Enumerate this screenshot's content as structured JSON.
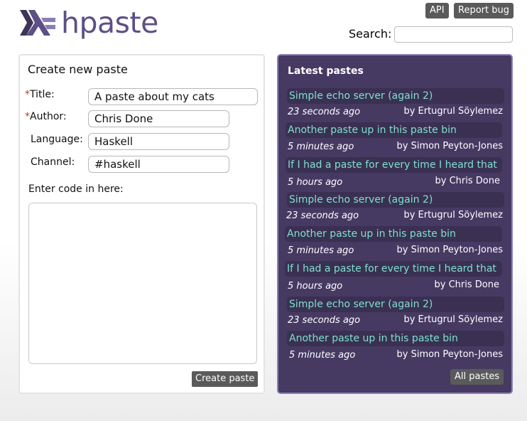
{
  "header": {
    "logo_text": "hpaste",
    "api_label": "API",
    "report_bug_label": "Report bug",
    "search_label": "Search:",
    "search_value": ""
  },
  "form": {
    "title": "Create new paste",
    "required_mark": "*",
    "title_label": "Title:",
    "title_value": "A paste about my cats",
    "author_label": "Author:",
    "author_value": "Chris Done",
    "language_label": "Language:",
    "language_value": "Haskell",
    "channel_label": "Channel:",
    "channel_value": "#haskell",
    "code_label": "Enter code in here:",
    "code_value": "",
    "submit_label": "Create paste"
  },
  "latest": {
    "title": "Latest pastes",
    "all_label": "All pastes",
    "items": [
      {
        "title": "Simple echo server (again 2)",
        "time": "23 seconds ago",
        "author": "by Ertugrul Söylemez"
      },
      {
        "title": "Another paste up in this paste bin",
        "time": "5 minutes ago",
        "author": "by Simon Peyton-Jones"
      },
      {
        "title": "If I had a paste for every time I heard that",
        "time": "5 hours ago",
        "author": "by Chris Done"
      },
      {
        "title": "Simple echo server (again 2)",
        "time": "23 seconds ago",
        "author": "by Ertugrul Söylemez"
      },
      {
        "title": "Another paste up in this paste bin",
        "time": "5 minutes ago",
        "author": "by Simon Peyton-Jones"
      },
      {
        "title": "If I had a paste for every time I heard that",
        "time": "5 hours ago",
        "author": "by Chris Done"
      },
      {
        "title": "Simple echo server (again 2)",
        "time": "23 seconds ago",
        "author": "by Ertugrul Söylemez"
      },
      {
        "title": "Another paste up in this paste bin",
        "time": "5 minutes ago",
        "author": "by Simon Peyton-Jones"
      }
    ]
  },
  "colors": {
    "panel_bg": "#463a63",
    "link": "#7fe0d0",
    "logo": "#5e4f86",
    "required": "#d2302a"
  },
  "icons": {
    "logo": "haskell-logo-icon"
  }
}
